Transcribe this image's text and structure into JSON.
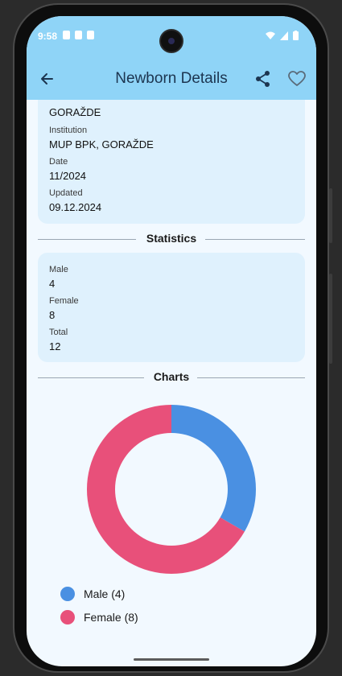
{
  "status": {
    "time": "9:58"
  },
  "header": {
    "title": "Newborn Details"
  },
  "details": {
    "partial_value": "GORAŽDE",
    "fields": [
      {
        "label": "Institution",
        "value": "MUP BPK, GORAŽDE"
      },
      {
        "label": "Date",
        "value": "11/2024"
      },
      {
        "label": "Updated",
        "value": "09.12.2024"
      }
    ]
  },
  "statistics": {
    "heading": "Statistics",
    "fields": [
      {
        "label": "Male",
        "value": "4"
      },
      {
        "label": "Female",
        "value": "8"
      },
      {
        "label": "Total",
        "value": "12"
      }
    ]
  },
  "charts": {
    "heading": "Charts"
  },
  "chart_data": {
    "type": "pie",
    "categories": [
      "Male (4)",
      "Female (8)"
    ],
    "values": [
      4,
      8
    ],
    "colors": [
      "#4a90e2",
      "#e8507a"
    ]
  },
  "colors": {
    "appbar": "#8fd4f7",
    "background": "#f2f9ff",
    "card": "#dff1fd",
    "male": "#4a90e2",
    "female": "#e8507a"
  },
  "icons": {
    "back": "arrow-left-icon",
    "share": "share-icon",
    "favorite": "heart-outline-icon"
  }
}
